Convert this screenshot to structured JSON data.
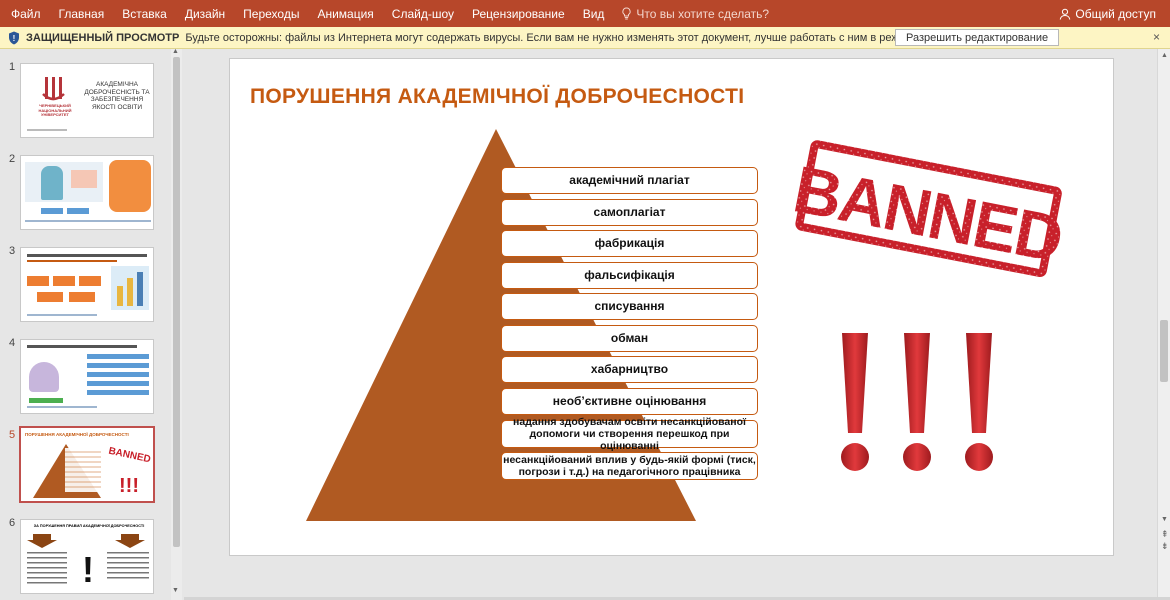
{
  "menu": {
    "tabs": [
      "Файл",
      "Главная",
      "Вставка",
      "Дизайн",
      "Переходы",
      "Анимация",
      "Слайд-шоу",
      "Рецензирование",
      "Вид"
    ],
    "tell_me": "Что вы хотите сделать?",
    "share": "Общий доступ"
  },
  "protected": {
    "title": "ЗАЩИЩЕННЫЙ ПРОСМОТР",
    "message": "Будьте осторожны: файлы из Интернета могут содержать вирусы. Если вам не нужно изменять этот документ, лучше работать с ним в режиме защищенного просмотра.",
    "enable_button": "Разрешить редактирование",
    "close": "×"
  },
  "thumbnails": {
    "numbers": [
      "1",
      "2",
      "3",
      "4",
      "5",
      "6"
    ],
    "active": "5",
    "slide1": {
      "title": "АКАДЕМІЧНА ДОБРОЧЕСНІСТЬ ТА ЗАБЕЗПЕЧЕННЯ ЯКОСТІ ОСВІТИ",
      "university": "ЧЕРНІВЕЦЬКИЙ НАЦІОНАЛЬНИЙ УНІВЕРСИТЕТ"
    },
    "slide5": {
      "title": "ПОРУШЕННЯ АКАДЕМІЧНОЇ ДОБРОЧЕСНОСТІ"
    },
    "slide6": {
      "title": "ЗА ПОРУШЕННЯ ПРАВИЛ АКАДЕМІЧНОЇ ДОБРОЧЕСНОСТІ"
    }
  },
  "slide": {
    "title": "ПОРУШЕННЯ АКАДЕМІЧНОЇ ДОБРОЧЕСНОСТІ",
    "levels": [
      "академічний плагіат",
      "самоплагіат",
      "фабрикація",
      "фальсифікація",
      "списування",
      "обман",
      "хабарництво",
      "необ’єктивне оцінювання",
      "надання здобувачам освіти несанкційованої допомоги чи створення перешкод при оцінюванні",
      "несанкційований вплив у будь-якій формі (тиск, погрози і т.д.) на педагогічного працівника"
    ],
    "stamp_text": "BANNED",
    "exclamations": "!!!"
  },
  "colors": {
    "ribbon": "#b7472a",
    "pyramid": "#b05a22",
    "title": "#c55a11",
    "stamp": "#c8202a"
  }
}
